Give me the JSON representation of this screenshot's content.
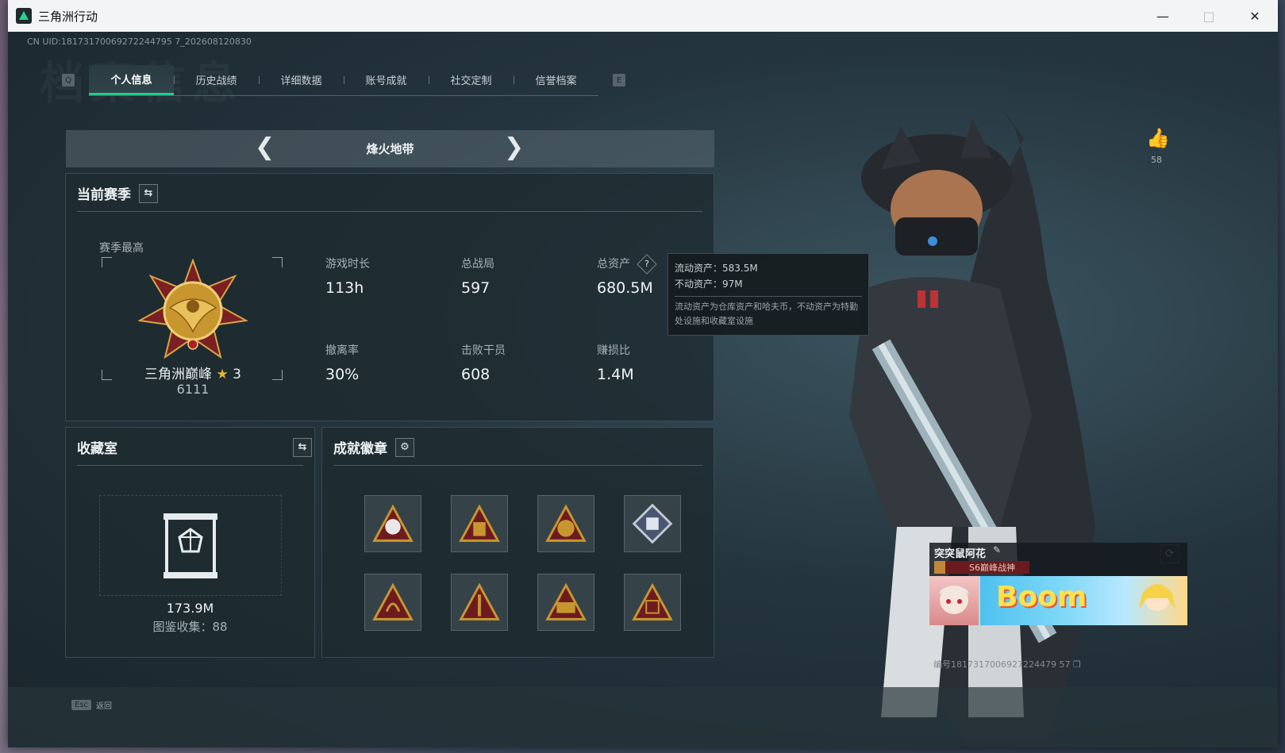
{
  "window": {
    "title": "三角洲行动"
  },
  "uid_line": "CN UID:18173170069272244795 7_202608120830",
  "watermark_title": "档案信息",
  "tabs": {
    "left_key": "Q",
    "right_key": "E",
    "items": [
      "个人信息",
      "历史战绩",
      "详细数据",
      "账号成就",
      "社交定制",
      "信誉档案"
    ],
    "active_index": 0
  },
  "mode": {
    "label": "烽火地带"
  },
  "season": {
    "title": "当前赛季",
    "best_label": "赛季最高",
    "rank_name": "三角洲巅峰",
    "rank_stars": "3",
    "rank_score": "6111",
    "stats": {
      "playtime": {
        "label": "游戏时长",
        "value": "113h"
      },
      "total_matches": {
        "label": "总战局",
        "value": "597"
      },
      "total_assets": {
        "label": "总资产",
        "value": "680.5M"
      },
      "extract_rate": {
        "label": "撤离率",
        "value": "30%"
      },
      "kills": {
        "label": "击败干员",
        "value": "608"
      },
      "profit_ratio": {
        "label": "赚损比",
        "value": "1.4M"
      }
    }
  },
  "tooltip": {
    "liquid": "流动资产：583.5M",
    "fixed": "不动资产：97M",
    "note": "流动资产为仓库资产和哈夫币，不动资产为特勤处设施和收藏室设施"
  },
  "collection": {
    "title": "收藏室",
    "value": "173.9M",
    "count_label": "图鉴收集：88"
  },
  "badges": {
    "title": "成就徽章",
    "count": 8
  },
  "likes": {
    "count": "58"
  },
  "namecard": {
    "name": "突突鼠阿花",
    "title": "S6巅峰战神",
    "banner_text": "Boom",
    "uid": "编号1817317006927224479 57"
  },
  "footer": {
    "esc_key": "Esc",
    "esc_label": "返回"
  },
  "colors": {
    "accent": "#27c88d",
    "panel": "#1e2a30",
    "gold": "#c8962f"
  }
}
